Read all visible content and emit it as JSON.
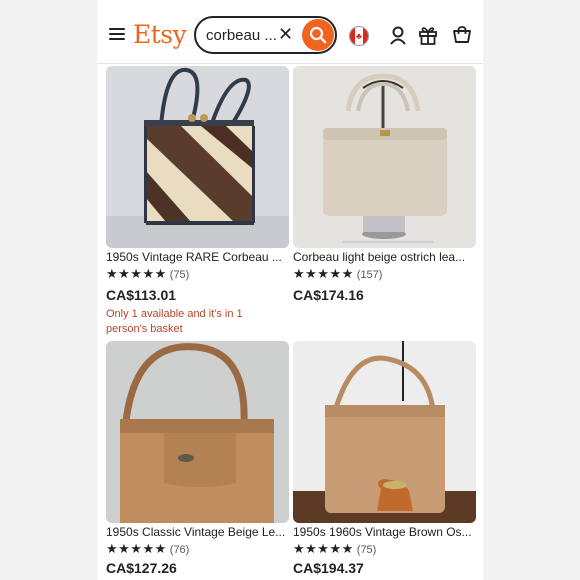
{
  "app": {
    "logo": "Etsy"
  },
  "search": {
    "query": "corbeau ...",
    "clear_symbol": "✕"
  },
  "colors": {
    "brand": "#f1641e",
    "scarcity": "#b6462c"
  },
  "icons": [
    "menu-icon",
    "search-icon",
    "canada-flag-icon",
    "account-icon",
    "gift-icon",
    "cart-icon"
  ],
  "listings": [
    {
      "title": "1950s Vintage RARE Corbeau ...",
      "stars": "★★★★★",
      "count": "(75)",
      "price": "CA$113.01",
      "note": "Only 1 available and it's in 1 person's basket"
    },
    {
      "title": "Corbeau light beige ostrich lea...",
      "stars": "★★★★★",
      "count": "(157)",
      "price": "CA$174.16",
      "note": ""
    },
    {
      "title": "1950s Classic Vintage Beige Le...",
      "stars": "★★★★★",
      "count": "(76)",
      "price": "CA$127.26",
      "note": ""
    },
    {
      "title": "1950s 1960s Vintage Brown Os...",
      "stars": "★★★★★",
      "count": "(75)",
      "price": "CA$194.37",
      "note": ""
    }
  ]
}
